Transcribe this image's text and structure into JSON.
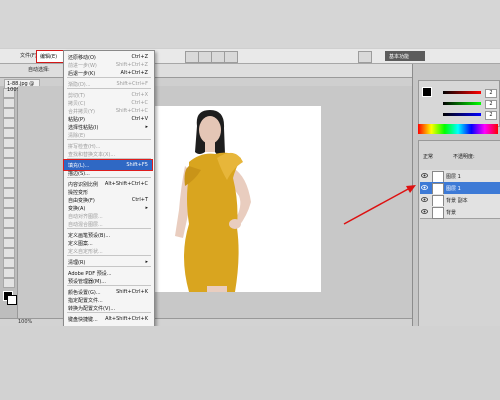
{
  "menubar": {
    "items": [
      "文件(F)",
      "编辑(E)"
    ],
    "tiny": "基本功能",
    "zoom_field": "100%"
  },
  "options": {
    "auto_select": "自动选择:"
  },
  "doc_tab": "1-88.jpg @ 100%",
  "edit_menu": [
    {
      "label": "还原移动(O)",
      "shortcut": "Ctrl+Z",
      "disabled": false
    },
    {
      "label": "前进一步(W)",
      "shortcut": "Shift+Ctrl+Z",
      "disabled": true
    },
    {
      "label": "后退一步(K)",
      "shortcut": "Alt+Ctrl+Z",
      "disabled": false
    },
    {
      "sep": true
    },
    {
      "label": "渐隐(D)...",
      "shortcut": "Shift+Ctrl+F",
      "disabled": true
    },
    {
      "sep": true
    },
    {
      "label": "剪切(T)",
      "shortcut": "Ctrl+X",
      "disabled": true
    },
    {
      "label": "拷贝(C)",
      "shortcut": "Ctrl+C",
      "disabled": true
    },
    {
      "label": "合并拷贝(Y)",
      "shortcut": "Shift+Ctrl+C",
      "disabled": true
    },
    {
      "label": "粘贴(P)",
      "shortcut": "Ctrl+V",
      "disabled": false
    },
    {
      "label": "选择性粘贴(I)",
      "shortcut": "▸",
      "disabled": false
    },
    {
      "label": "清除(E)",
      "shortcut": "",
      "disabled": true
    },
    {
      "sep": true
    },
    {
      "label": "拼写检查(H)...",
      "shortcut": "",
      "disabled": true
    },
    {
      "label": "查找和替换文本(X)...",
      "shortcut": "",
      "disabled": true
    },
    {
      "sep": true
    },
    {
      "label": "填充(L)...",
      "shortcut": "Shift+F5",
      "disabled": false,
      "highlight": true
    },
    {
      "label": "描边(S)...",
      "shortcut": "",
      "disabled": false
    },
    {
      "sep": true
    },
    {
      "label": "内容识别比例",
      "shortcut": "Alt+Shift+Ctrl+C",
      "disabled": false
    },
    {
      "label": "操控变形",
      "shortcut": "",
      "disabled": false
    },
    {
      "label": "自由变换(F)",
      "shortcut": "Ctrl+T",
      "disabled": false
    },
    {
      "label": "变换(A)",
      "shortcut": "▸",
      "disabled": false
    },
    {
      "label": "自动对齐图层...",
      "shortcut": "",
      "disabled": true
    },
    {
      "label": "自动混合图层...",
      "shortcut": "",
      "disabled": true
    },
    {
      "sep": true
    },
    {
      "label": "定义画笔预设(B)...",
      "shortcut": "",
      "disabled": false
    },
    {
      "label": "定义图案...",
      "shortcut": "",
      "disabled": false
    },
    {
      "label": "定义自定形状...",
      "shortcut": "",
      "disabled": true
    },
    {
      "sep": true
    },
    {
      "label": "清理(R)",
      "shortcut": "▸",
      "disabled": false
    },
    {
      "sep": true
    },
    {
      "label": "Adobe PDF 预设...",
      "shortcut": "",
      "disabled": false
    },
    {
      "label": "预设管理器(M)...",
      "shortcut": "",
      "disabled": false
    },
    {
      "sep": true
    },
    {
      "label": "颜色设置(G)...",
      "shortcut": "Shift+Ctrl+K",
      "disabled": false
    },
    {
      "label": "指定配置文件...",
      "shortcut": "",
      "disabled": false
    },
    {
      "label": "转换为配置文件(V)...",
      "shortcut": "",
      "disabled": false
    },
    {
      "sep": true
    },
    {
      "label": "键盘快捷键...",
      "shortcut": "Alt+Shift+Ctrl+K",
      "disabled": false
    }
  ],
  "right": {
    "essentials": "基本功能",
    "color_values": [
      "2",
      "2",
      "2"
    ],
    "layers_mode": "正常",
    "opacity_label": "不透明度:",
    "layers": [
      {
        "name": "图层 1",
        "selected": false
      },
      {
        "name": "图层 1",
        "selected": true
      },
      {
        "name": "背景 副本",
        "selected": false
      },
      {
        "name": "背景",
        "selected": false
      }
    ]
  },
  "colors": {
    "accent": "#2f68c4",
    "highlight_border": "#e01c1c",
    "dress": "#d9a51f"
  }
}
